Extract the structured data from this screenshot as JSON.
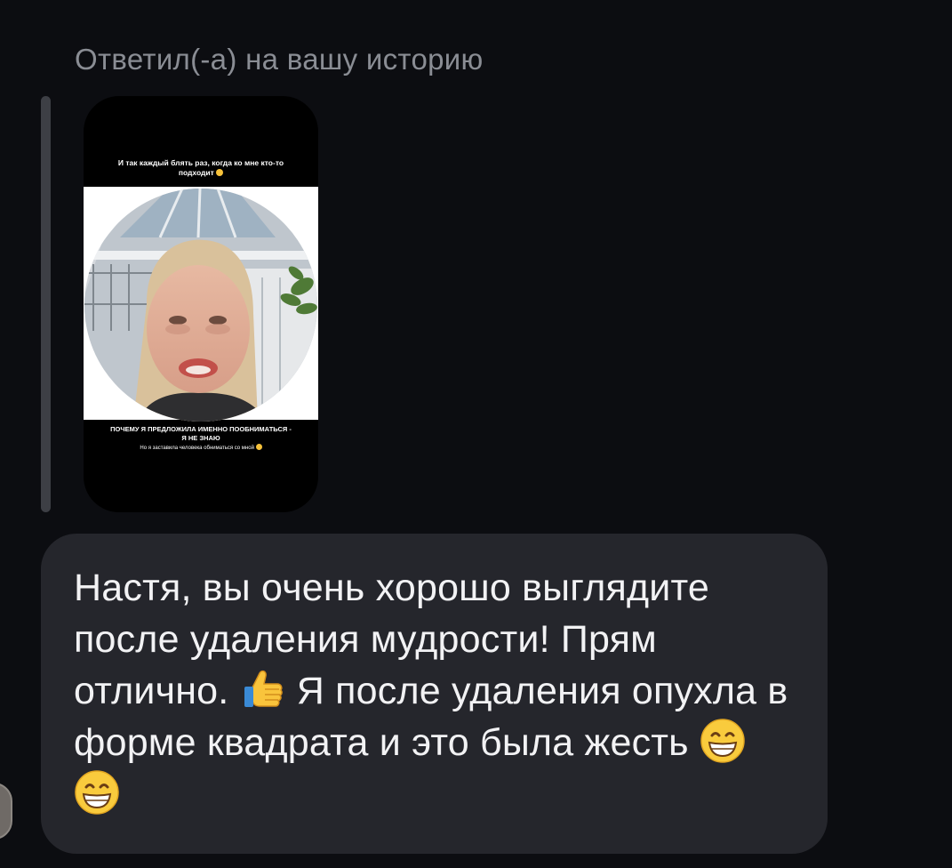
{
  "reply": {
    "header": "Ответил(-а) на вашу историю"
  },
  "story": {
    "top_caption": "И так каждый блять раз, когда ко мне кто-то подходит",
    "top_caption_emoji": "grinning-face-icon",
    "bottom_caption_main": "ПОЧЕМУ Я ПРЕДЛОЖИЛА ИМЕННО ПООБНИМАТЬСЯ - Я НЕ ЗНАЮ",
    "bottom_caption_sub": "Но я заставила человека обниматься со мной",
    "bottom_caption_emoji": "grimacing-face-icon"
  },
  "message": {
    "part1": "Настя, вы очень хорошо выглядите после удаления мудрости! Прям отлично. ",
    "emoji1": "thumbs-up-icon",
    "part2": " Я после удаления опухла в форме квадрата и это была жесть ",
    "emoji2": "beaming-face-icon",
    "emoji3": "beaming-face-icon"
  },
  "colors": {
    "background": "#0c0d11",
    "bubble": "#25262c",
    "header_text": "#8a8d94",
    "message_text": "#f2f2f4"
  }
}
